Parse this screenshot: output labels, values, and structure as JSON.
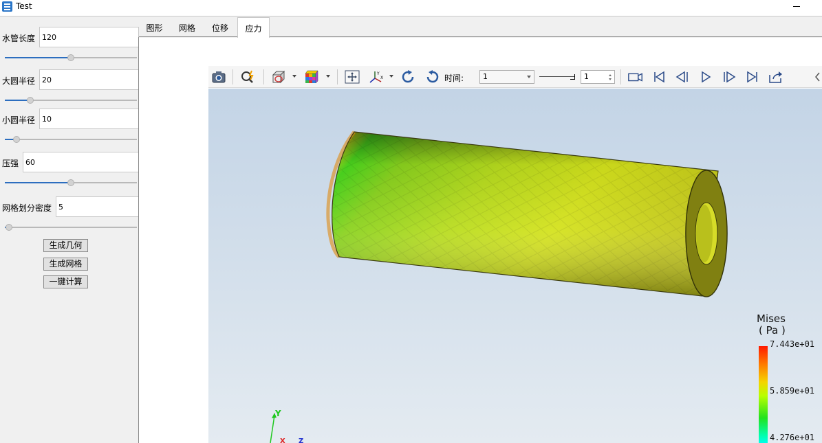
{
  "window": {
    "title": "Test"
  },
  "params": {
    "pipe_length": {
      "label": "水管长度",
      "value": "120",
      "slider_fraction": 0.5
    },
    "outer_radius": {
      "label": "大圆半径",
      "value": "20",
      "slider_fraction": 0.2
    },
    "inner_radius": {
      "label": "小圆半径",
      "value": "10",
      "slider_fraction": 0.09
    },
    "pressure": {
      "label": "压强",
      "value": "60",
      "slider_fraction": 0.5
    },
    "mesh_density": {
      "label": "网格划分密度",
      "value": "5",
      "slider_fraction": 0.03
    }
  },
  "buttons": {
    "generate_geometry": "生成几何",
    "generate_mesh": "生成网格",
    "compute": "一键计算"
  },
  "tabs": [
    "图形",
    "网格",
    "位移",
    "应力"
  ],
  "active_tab": "应力",
  "toolbar": {
    "time_label": "时间:",
    "time_value": "1",
    "step_value": "1"
  },
  "legend": {
    "title_line1": "Mises",
    "title_line2": "( Pa )",
    "max": "7.443e+01",
    "mid": "5.859e+01",
    "min": "4.276e+01"
  },
  "axes": {
    "y": "Y",
    "x": "X",
    "z": "Z"
  },
  "colors": {
    "accent": "#2c6ebf",
    "max_stress": "#ff1a00",
    "mid_stress": "#b8ff00",
    "min_stress": "#00ffff"
  }
}
